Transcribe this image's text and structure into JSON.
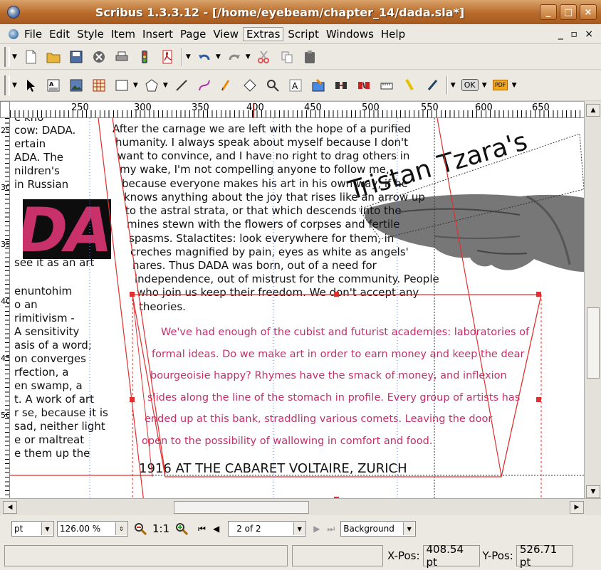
{
  "window": {
    "title": "Scribus 1.3.3.12 - [/home/eyebeam/chapter_14/dada.sla*]",
    "buttons": [
      "_",
      "□",
      "×"
    ]
  },
  "menu": {
    "items": [
      "File",
      "Edit",
      "Style",
      "Item",
      "Insert",
      "Page",
      "View",
      "Extras",
      "Script",
      "Windows",
      "Help"
    ],
    "active": "Extras",
    "mdi_controls": "_ ▫ ×"
  },
  "toolbar1": {
    "icons": [
      "new-doc-icon",
      "open-folder-icon",
      "save-icon",
      "close-doc-icon",
      "print-icon",
      "preflight-icon",
      "pdf-export-icon",
      "undo-icon",
      "redo-icon",
      "cut-icon",
      "copy-icon",
      "paste-icon"
    ]
  },
  "toolbar2": {
    "icons": [
      "select-arrow-icon",
      "text-frame-icon",
      "image-frame-icon",
      "table-icon",
      "rectangle-icon",
      "polygon-icon",
      "line-icon",
      "bezier-icon",
      "freehand-icon",
      "rotate-icon",
      "zoom-icon",
      "edit-content-icon",
      "edit-text-icon",
      "link-frames-icon",
      "unlink-frames-icon",
      "measure-icon",
      "copy-properties-icon",
      "eyedropper-icon"
    ],
    "ok_label": "OK",
    "pdf_label": "PDF"
  },
  "ruler": {
    "labels": [
      "250",
      "300",
      "350",
      "400",
      "450",
      "500",
      "550",
      "600",
      "650"
    ],
    "vertical_labels": [
      "250",
      "300",
      "350",
      "400",
      "450",
      "500"
    ]
  },
  "page": {
    "left_column": [
      "e kno",
      "cow: DADA.",
      "ertain",
      "ADA. The",
      "nildren's",
      "in Russian",
      "see it as an art",
      "enuntohim",
      "o an",
      "rimitivism -",
      "A sensitivity",
      "asis of a word;",
      "on converges",
      "rfection, a",
      "en swamp, a",
      "t. A work of art",
      "r se, because it is",
      "sad, neither light",
      "e or maltreat",
      "e them up the"
    ],
    "dada_graphic": "DA.",
    "main_text": [
      "After the carnage we are left with the hope of a purified",
      "humanity. I always speak about myself because I don't",
      "want to convince, and I have no right to drag others in",
      "my wake, I'm not compelling anyone to follow me,",
      "because everyone makes his art in his own way, if he",
      "knows anything about the joy that rises like an arrow up",
      "to the astral strata, or that which descends into the",
      "mines stewn with the flowers of corpses and fertile",
      "spasms. Stalactites: look everywhere for them, in",
      "creches magnified by pain, eyes as white as angels'",
      "hares. Thus DADA was born, out of a need for",
      "independence, out of mistrust for the community. People",
      "who join us keep their freedom. We don't accept any",
      "theories."
    ],
    "rotated_title": "Tristan Tzara's",
    "red_text": [
      "We've had enough of the cubist and futurist academies: laboratories of",
      "formal ideas. Do we make art in order to earn money and keep the dear",
      "bourgeoisie happy? Rhymes have the smack of money, and inflexion",
      "slides along the line of the stomach in profile. Every group of artists has",
      "ended up at this bank, straddling various comets. Leaving the door",
      "open to the possibility of wallowing in comfort and food."
    ],
    "caption": "1916 AT THE CABARET VOLTAIRE, ZURICH"
  },
  "bottombar": {
    "unit": "pt",
    "zoom": "126.00 %",
    "zoom_one_to_one": "1:1",
    "page_indicator": "2 of 2",
    "layer": "Background"
  },
  "status": {
    "xpos_label": "X-Pos:",
    "xpos_value": "408.54 pt",
    "ypos_label": "Y-Pos:",
    "ypos_value": "526.71 pt"
  }
}
